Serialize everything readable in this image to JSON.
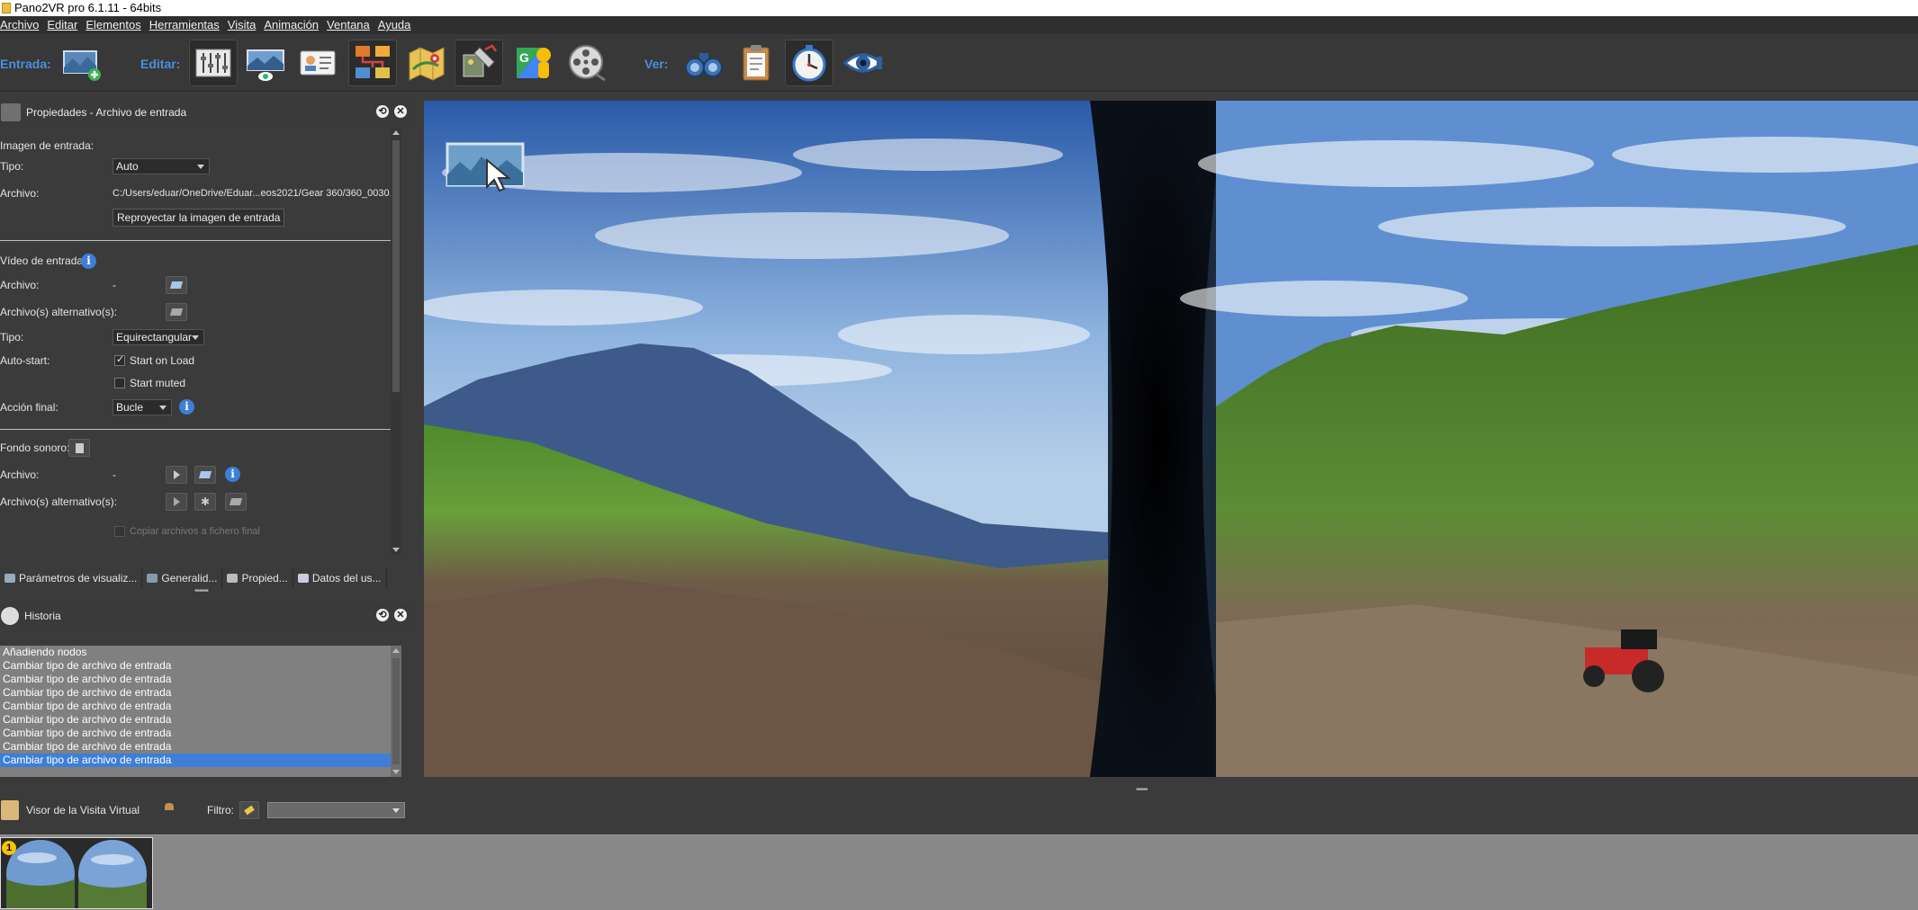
{
  "window": {
    "title": "Pano2VR pro 6.1.11 - 64bits"
  },
  "menu": [
    {
      "label": "Archivo"
    },
    {
      "label": "Editar"
    },
    {
      "label": "Elementos"
    },
    {
      "label": "Herramientas"
    },
    {
      "label": "Visita"
    },
    {
      "label": "Animación"
    },
    {
      "label": "Ventana"
    },
    {
      "label": "Ayuda"
    }
  ],
  "toolbar": {
    "entrada_label": "Entrada:",
    "editar_label": "Editar:",
    "ver_label": "Ver:",
    "entrada_buttons": [
      {
        "icon": "add-panorama-icon"
      }
    ],
    "editar_buttons": [
      {
        "icon": "sliders-icon"
      },
      {
        "icon": "viewing-parameters-icon"
      },
      {
        "icon": "user-data-icon"
      },
      {
        "icon": "hotspot-editor-icon"
      },
      {
        "icon": "map-icon"
      },
      {
        "icon": "patch-editor-icon"
      },
      {
        "icon": "google-street-view-icon"
      },
      {
        "icon": "film-reel-icon"
      }
    ],
    "ver_buttons": [
      {
        "icon": "binoculars-icon"
      },
      {
        "icon": "clipboard-icon"
      },
      {
        "icon": "stopwatch-icon"
      },
      {
        "icon": "eye-viewer-icon"
      }
    ]
  },
  "properties": {
    "header": "Propiedades - Archivo de entrada",
    "imagen_section": "Imagen de entrada:",
    "tipo_label": "Tipo:",
    "tipo_value": "Auto",
    "archivo_label": "Archivo:",
    "archivo_value": "C:/Users/eduar/OneDrive/Eduar...eos2021/Gear 360/360_0030.JPG",
    "reproject_button": "Reproyectar la imagen de entrada",
    "video_section": "Vídeo de entrada:",
    "video_archivo_label": "Archivo:",
    "video_archivo_value": "-",
    "video_alt_label": "Archivo(s) alternativo(s):",
    "video_tipo_label": "Tipo:",
    "video_tipo_value": "Equirectangular",
    "autostart_label": "Auto-start:",
    "start_on_load": "Start on Load",
    "start_on_load_checked": true,
    "start_muted": "Start muted",
    "start_muted_checked": false,
    "accion_final_label": "Acción final:",
    "accion_final_value": "Bucle",
    "fondo_section": "Fondo sonoro:",
    "sonido_archivo_label": "Archivo:",
    "sonido_archivo_value": "-",
    "sonido_alt_label": "Archivo(s) alternativo(s):",
    "copiar_label": "Copiar archivos a fichero final"
  },
  "tabs": [
    {
      "label": "Parámetros de visualiz..."
    },
    {
      "label": "Generalid..."
    },
    {
      "label": "Propied..."
    },
    {
      "label": "Datos del us..."
    }
  ],
  "history": {
    "header": "Historia",
    "items": [
      {
        "label": "Añadiendo nodos"
      },
      {
        "label": "Cambiar tipo de archivo de entrada"
      },
      {
        "label": "Cambiar tipo de archivo de entrada"
      },
      {
        "label": "Cambiar tipo de archivo de entrada"
      },
      {
        "label": "Cambiar tipo de archivo de entrada"
      },
      {
        "label": "Cambiar tipo de archivo de entrada"
      },
      {
        "label": "Cambiar tipo de archivo de entrada"
      },
      {
        "label": "Cambiar tipo de archivo de entrada"
      },
      {
        "label": "Cambiar tipo de archivo de entrada"
      }
    ],
    "selected_index": 8
  },
  "tour_viewer": {
    "label": "Visor de la Visita Virtual",
    "filter_label": "Filtro:",
    "filter_value": ""
  },
  "nodes": [
    {
      "badge": "1"
    }
  ],
  "colors": {
    "accent": "#3d7fd6",
    "toolbar_label": "#4a8fe0",
    "badge": "#f5c400"
  }
}
